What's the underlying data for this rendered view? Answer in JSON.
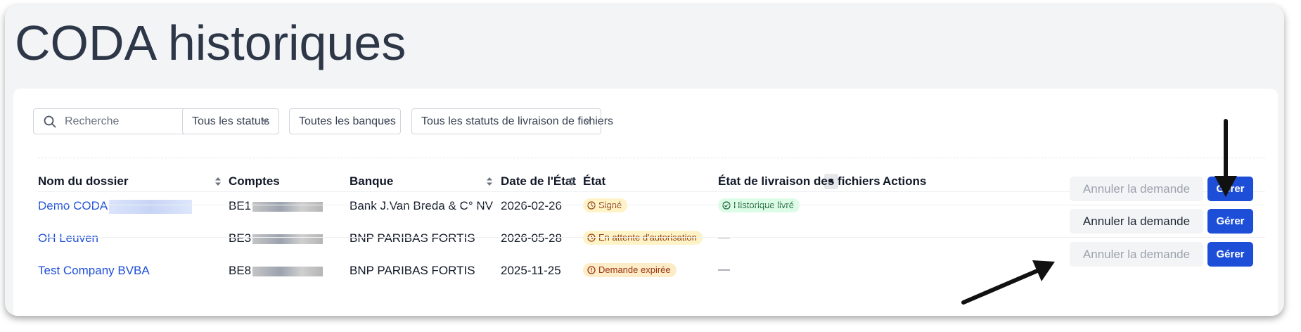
{
  "page": {
    "title": "CODA historiques"
  },
  "filters": {
    "search_placeholder": "Recherche",
    "status": "Tous les statuts",
    "banks": "Toutes les banques",
    "delivery": "Tous les statuts de livraison de fichiers"
  },
  "table": {
    "columns": [
      "Nom du dossier",
      "Comptes",
      "Banque",
      "Date de l'État",
      "État",
      "État de livraison des fichiers",
      "Actions"
    ],
    "rows": [
      {
        "name": "Demo CODA",
        "account_prefix": "BE1",
        "bank": "Bank J.Van Breda & C° NV",
        "date": "2026-02-26",
        "status": "Signé",
        "delivery": "Historique livré",
        "cancel": "Annuler la demande",
        "manage": "Gérer"
      },
      {
        "name": "OH Leuven",
        "account_prefix": "BE3",
        "bank": "BNP PARIBAS FORTIS",
        "date": "2026-05-28",
        "status": "En attente d'autorisation",
        "delivery": "—",
        "cancel": "Annuler la demande",
        "manage": "Gérer"
      },
      {
        "name": "Test Company BVBA",
        "account_prefix": "BE8",
        "bank": "BNP PARIBAS FORTIS",
        "date": "2025-11-25",
        "status": "Demande expirée",
        "delivery": "—",
        "cancel": "Annuler la demande",
        "manage": "Gérer"
      }
    ]
  },
  "icons": {
    "search": "search-icon",
    "chevron": "chevron-down-icon",
    "sort": "sort-icon",
    "clock": "clock-icon",
    "check": "check-circle-icon",
    "alert": "alert-circle-icon",
    "arrow": "annotation-arrow"
  },
  "colors": {
    "link": "#1d4ed8",
    "primary_button": "#1d4ed8",
    "badge_yellow": "#fef3c7",
    "badge_green": "#dcfce7",
    "badge_orange": "#fdecc8"
  }
}
